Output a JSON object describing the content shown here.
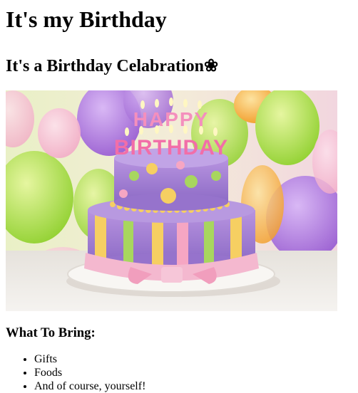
{
  "page": {
    "heading": "It's my Birthday",
    "subheading": "It's a Birthday Celabration❀"
  },
  "image": {
    "icon": "birthday-cake-image",
    "cake_topper_line1": "HAPPY",
    "cake_topper_line2": "BIRTHDAY"
  },
  "bring": {
    "title": "What To Bring:",
    "items": [
      "Gifts",
      "Foods",
      "And of course, yourself!"
    ]
  },
  "colors": {
    "balloon_purple": "#a26ad8",
    "balloon_green": "#a6e04a",
    "balloon_orange": "#f4a83a",
    "cake_purple": "#a985d6",
    "ribbon_pink": "#f4b8cf"
  }
}
